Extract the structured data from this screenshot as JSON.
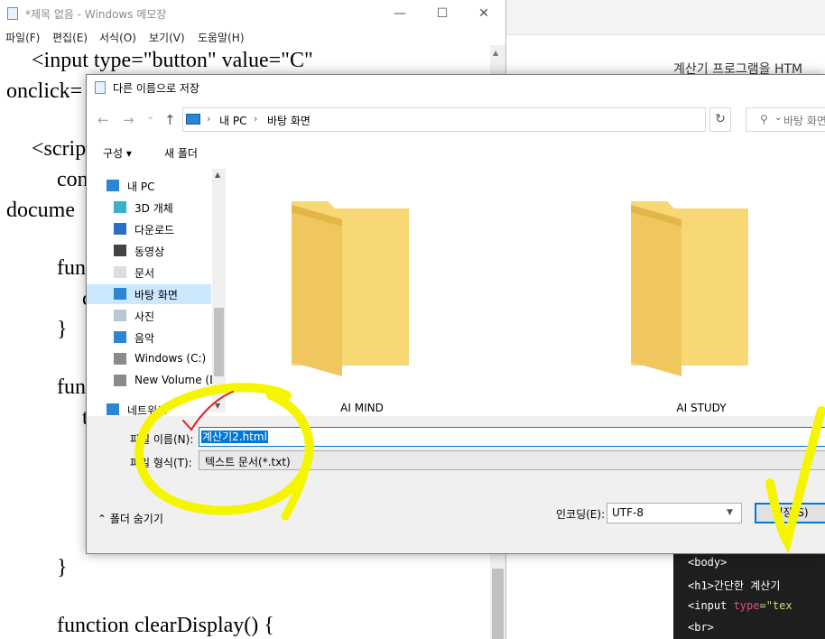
{
  "background_page": {
    "heading": "계산기 프로그램을 HTM",
    "code_lines": [
      {
        "indent": "",
        "text": "<body>",
        "attr": "",
        "str": ""
      },
      {
        "indent": "    ",
        "text": "<h1>간단한 계산기",
        "attr": "",
        "str": ""
      },
      {
        "indent": "    ",
        "text": "<input ",
        "attr": "type",
        "str": "=\"tex"
      },
      {
        "indent": "    ",
        "text": "<br>",
        "attr": "",
        "str": ""
      }
    ]
  },
  "notepad": {
    "title": "*제목 없음 - Windows 메모장",
    "window_controls": {
      "minimize": "—",
      "maximize": "☐",
      "close": "✕"
    },
    "menu": [
      "파일(F)",
      "편집(E)",
      "서식(O)",
      "보기(V)",
      "도움말(H)"
    ],
    "lines": [
      "<input type=\"button\" value=\"C\"",
      "onclick=",
      "<scrip",
      "con",
      "docume",
      "fun",
      "c",
      "}",
      "fun",
      "t",
      "}",
      "function clearDisplay() {"
    ]
  },
  "dialog": {
    "title": "다른 이름으로 저장",
    "nav": {
      "back": "←",
      "forward": "→",
      "recent": "⌄",
      "up": "↑",
      "refresh": "↻"
    },
    "breadcrumb": [
      "내 PC",
      "바탕 화면"
    ],
    "search_placeholder": "바탕 화면",
    "toolbar": {
      "organize": "구성 ▾",
      "new_folder": "새 폴더"
    },
    "tree": [
      {
        "label": "내 PC",
        "icon": "pc-icon",
        "indent": 0,
        "selected": false
      },
      {
        "label": "3D 개체",
        "icon": "3d-objects-icon",
        "indent": 1,
        "selected": false
      },
      {
        "label": "다운로드",
        "icon": "download-icon",
        "indent": 1,
        "selected": false
      },
      {
        "label": "동영상",
        "icon": "video-icon",
        "indent": 1,
        "selected": false
      },
      {
        "label": "문서",
        "icon": "document-icon",
        "indent": 1,
        "selected": false
      },
      {
        "label": "바탕 화면",
        "icon": "desktop-icon",
        "indent": 1,
        "selected": true
      },
      {
        "label": "사진",
        "icon": "pictures-icon",
        "indent": 1,
        "selected": false
      },
      {
        "label": "음악",
        "icon": "music-icon",
        "indent": 1,
        "selected": false
      },
      {
        "label": "Windows (C:)",
        "icon": "drive-icon",
        "indent": 1,
        "selected": false
      },
      {
        "label": "New Volume (D",
        "icon": "drive-icon",
        "indent": 1,
        "selected": false
      },
      {
        "label": "네트워크",
        "icon": "network-icon",
        "indent": 0,
        "selected": false
      }
    ],
    "folders": [
      "AI MIND",
      "AI STUDY"
    ],
    "filename_label": "파일 이름(N):",
    "filename_value": "계산기2.html",
    "filetype_label": "파일 형식(T):",
    "filetype_value": "텍스트 문서(*.txt)",
    "hide_folders": "⌃ 폴더 숨기기",
    "encoding_label": "인코딩(E):",
    "encoding_value": "UTF-8",
    "save_button": "저장(S)"
  },
  "colors": {
    "accent": "#0078d7",
    "selection": "#cce8ff",
    "folder_body": "#f8d775",
    "folder_front": "#f0c75e",
    "highlight_marker": "#f5f500",
    "check_mark": "#e02020"
  }
}
